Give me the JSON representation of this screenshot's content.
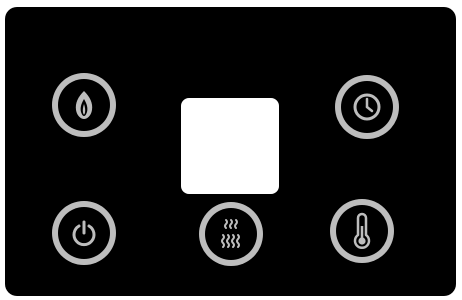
{
  "panel": {
    "background": "#000000",
    "ring_color": "#bdbdbd",
    "icon_color": "#bdbdbd"
  },
  "buttons": [
    {
      "icon": "flame-icon"
    },
    {
      "icon": "clock-icon"
    },
    {
      "icon": "power-icon"
    },
    {
      "icon": "heat-waves-icon"
    },
    {
      "icon": "thermometer-icon"
    }
  ],
  "display": {
    "text": ""
  }
}
